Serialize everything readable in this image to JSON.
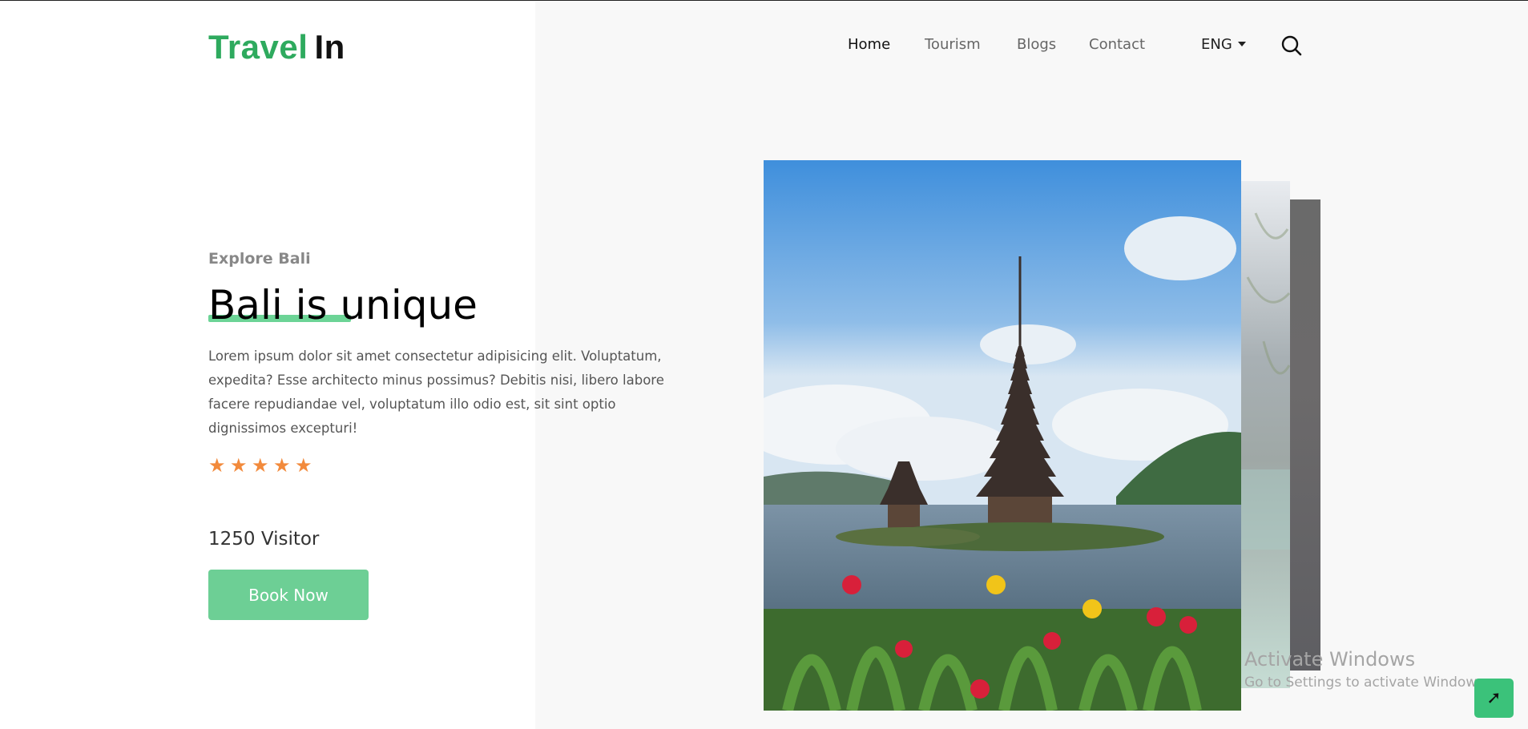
{
  "brand": {
    "part1": "Travel",
    "part2": "In",
    "color1": "#2eaa5e",
    "color2": "#111111"
  },
  "nav": {
    "items": [
      {
        "label": "Home",
        "active": true
      },
      {
        "label": "Tourism",
        "active": false
      },
      {
        "label": "Blogs",
        "active": false
      },
      {
        "label": "Contact",
        "active": false
      }
    ],
    "language": "ENG",
    "search_icon": "search-icon"
  },
  "hero": {
    "eyebrow": "Explore Bali",
    "title": "Bali is unique",
    "description": "Lorem ipsum dolor sit amet consectetur adipisicing elit. Voluptatum, expedita? Esse architecto minus possimus? Debitis nisi, libero labore facere repudiandae vel, voluptatum illo odio est, sit sint optio dignissimos excepturi!",
    "rating": 5,
    "rating_color": "#f28a3c",
    "visitors": "1250 Visitor",
    "cta_label": "Book Now",
    "cta_color": "#6dcf95"
  },
  "gallery": {
    "main_image": "bali-temple-photo",
    "stacked_cards": 2
  },
  "overlay": {
    "watermark_title": "Activate Windows",
    "watermark_sub": "Go to Settings to activate Windows.",
    "scroll_top_icon": "arrow-up-icon"
  }
}
